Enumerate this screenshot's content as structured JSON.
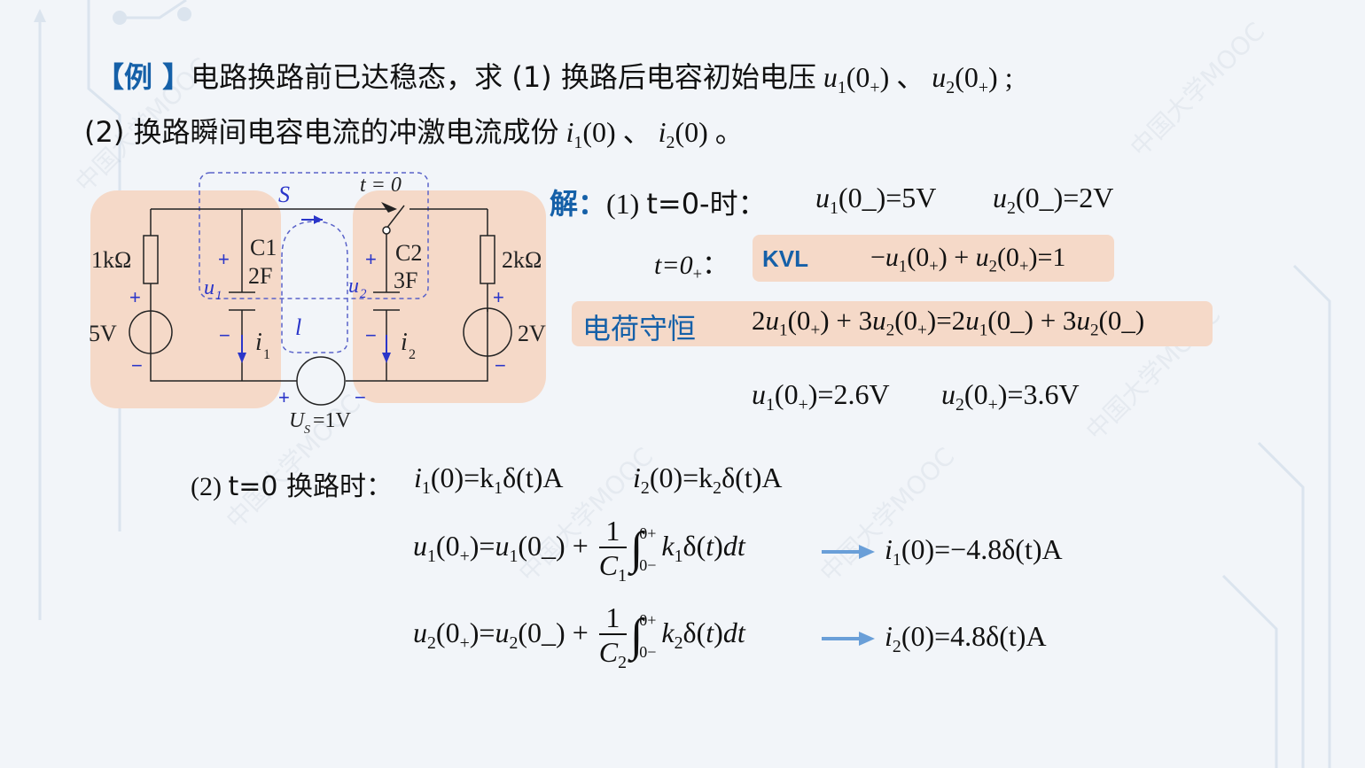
{
  "problem": {
    "tag": "【例 】",
    "line1_text": "电路换路前已达稳态，求 (1) 换路后电容初始电压",
    "line1_sep": "、",
    "line1_end": ";",
    "line2_lead": "(2) 换路瞬间电容电流的冲激电流成份",
    "line2_sep": "、",
    "line2_end": "。"
  },
  "circuit": {
    "switch_label": "S",
    "time_label": "t = 0",
    "r1": "1kΩ",
    "r2": "2kΩ",
    "c1": "C1",
    "c1_val": "2F",
    "c2": "C2",
    "c2_val": "3F",
    "src_left": "5V",
    "src_right": "2V",
    "us": "U",
    "us_sub": "S",
    "us_val": "=1V",
    "loop": "l",
    "u1": "u",
    "u1_sub": "1",
    "u2": "u",
    "u2_sub": "2",
    "i1": "i",
    "i1_sub": "1",
    "i2": "i",
    "i2_sub": "2"
  },
  "solution": {
    "label": "解：",
    "step1_lead": "(1) ",
    "step1_time": "t=0-时：",
    "u1_before": "=5V",
    "u2_before": "=2V",
    "t0plus": "t=0",
    "t0plus_colon": "：",
    "kvl_tag": "KVL",
    "kvl_eq_rhs": "=1",
    "charge_tag": "电荷守恒",
    "u1_after_val": "=2.6V",
    "u2_after_val": "=3.6V",
    "step2_lead": "(2) ",
    "step2_time": "t=0 换路时：",
    "i1_eq": "=k",
    "i2_eq": "=k",
    "impulse_tail": "δ(t)A",
    "int_upper": "0+",
    "int_lower": "0−",
    "frac_num": "1",
    "i1_result": "=−4.8δ(t)A",
    "i2_result": "=4.8δ(t)A"
  },
  "watermark_text": "中国大学MOOC",
  "colors": {
    "accent_blue": "#1560a8",
    "highlight": "#f5d9c8",
    "circuit_blue": "#2a35c9",
    "arrow_blue": "#6a9fd8"
  }
}
